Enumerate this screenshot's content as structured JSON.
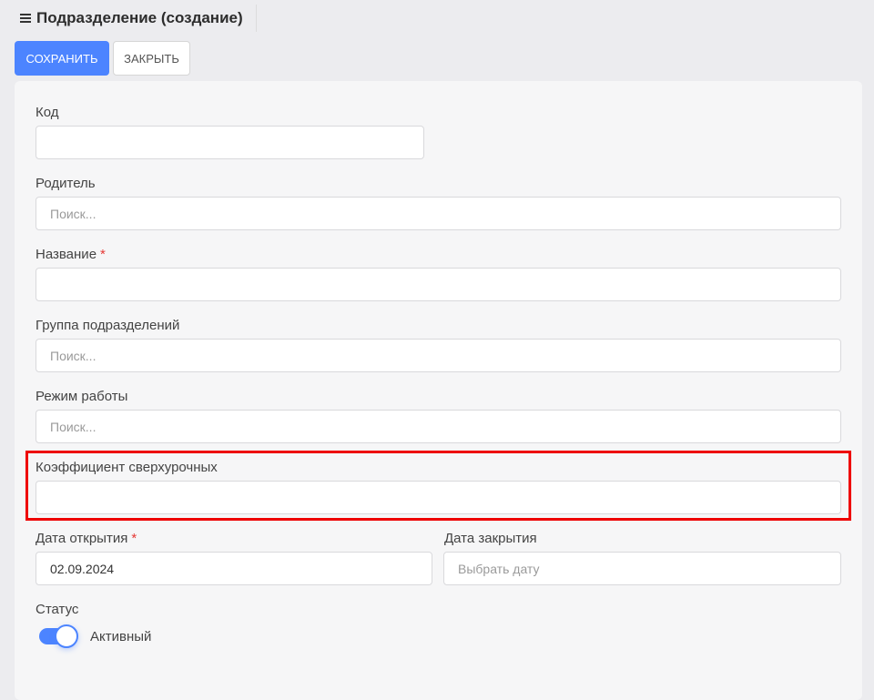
{
  "header": {
    "title": "Подразделение (создание)"
  },
  "toolbar": {
    "save_label": "СОХРАНИТЬ",
    "close_label": "ЗАКРЫТЬ"
  },
  "form": {
    "code": {
      "label": "Код",
      "value": ""
    },
    "parent": {
      "label": "Родитель",
      "placeholder": "Поиск..."
    },
    "name": {
      "label": "Название",
      "required_mark": "*",
      "value": ""
    },
    "group": {
      "label": "Группа подразделений",
      "placeholder": "Поиск..."
    },
    "work_mode": {
      "label": "Режим работы",
      "placeholder": "Поиск..."
    },
    "overtime_coef": {
      "label": "Коэффициент сверхурочных",
      "value": ""
    },
    "open_date": {
      "label": "Дата открытия",
      "required_mark": "*",
      "value": "02.09.2024"
    },
    "close_date": {
      "label": "Дата закрытия",
      "placeholder": "Выбрать дату"
    },
    "status": {
      "label": "Статус",
      "toggle_label": "Активный",
      "enabled": true
    }
  },
  "colors": {
    "accent": "#4c84ff",
    "required": "#e53935",
    "highlight": "#ee0000"
  }
}
